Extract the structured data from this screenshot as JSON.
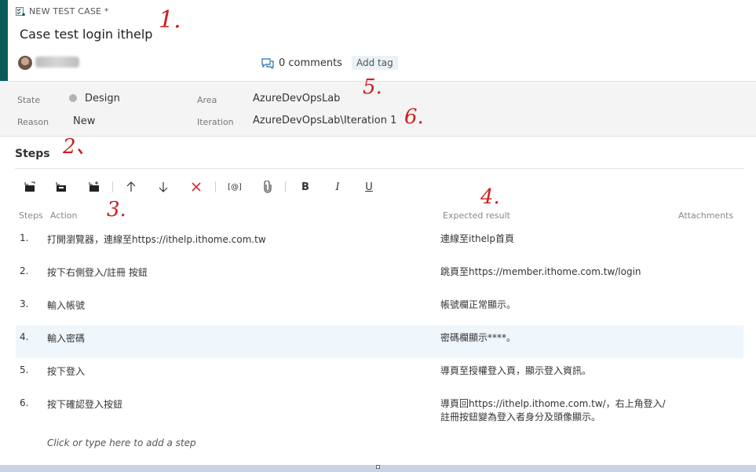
{
  "header": {
    "type_label": "NEW TEST CASE *",
    "title": "Case test login ithelp",
    "comments_label": "0 comments",
    "add_tag_label": "Add tag"
  },
  "fields": {
    "state_label": "State",
    "state_value": "Design",
    "reason_label": "Reason",
    "reason_value": "New",
    "area_label": "Area",
    "area_value": "AzureDevOpsLab",
    "iteration_label": "Iteration",
    "iteration_value": "AzureDevOpsLab\\Iteration 1"
  },
  "steps": {
    "title": "Steps",
    "columns": {
      "steps": "Steps",
      "action": "Action",
      "expected": "Expected result",
      "attachments": "Attachments"
    },
    "rows": [
      {
        "num": "1.",
        "action": "打開瀏覽器，連線至https://ithelp.ithome.com.tw",
        "expected": "連線至ithelp首頁"
      },
      {
        "num": "2.",
        "action": "按下右側登入/註冊 按鈕",
        "expected": "跳頁至https://member.ithome.com.tw/login"
      },
      {
        "num": "3.",
        "action": "輸入帳號",
        "expected": "帳號欄正常顯示。"
      },
      {
        "num": "4.",
        "action": "輸入密碼",
        "expected": "密碼欄顯示****。"
      },
      {
        "num": "5.",
        "action": "按下登入",
        "expected": "導頁至授權登入頁，顯示登入資訊。"
      },
      {
        "num": "6.",
        "action": "按下確認登入按鈕",
        "expected": "導頁回https://ithelp.ithome.com.tw/，右上角登入/\n註冊按鈕變為登入者身分及頭像顯示。"
      }
    ],
    "add_step_placeholder": "Click or type here to add a step"
  },
  "toolbar": {
    "icons": [
      "insert-step-icon",
      "insert-shared-step-icon",
      "create-shared-step-icon",
      "move-up-icon",
      "move-down-icon",
      "delete-icon",
      "parameter-icon",
      "attachment-icon",
      "bold-icon",
      "italic-icon",
      "underline-icon"
    ],
    "param_label": "[@]",
    "bold_label": "B",
    "italic_label": "I",
    "underline_label": "U"
  },
  "annotations": [
    "1.",
    "2、",
    "3.",
    "4.",
    "5.",
    "6."
  ],
  "colors": {
    "left_bar": "#0b5a5a",
    "annotation": "#cc1f1f",
    "delete": "#d13438",
    "highlight_row": "#eff6fc"
  }
}
